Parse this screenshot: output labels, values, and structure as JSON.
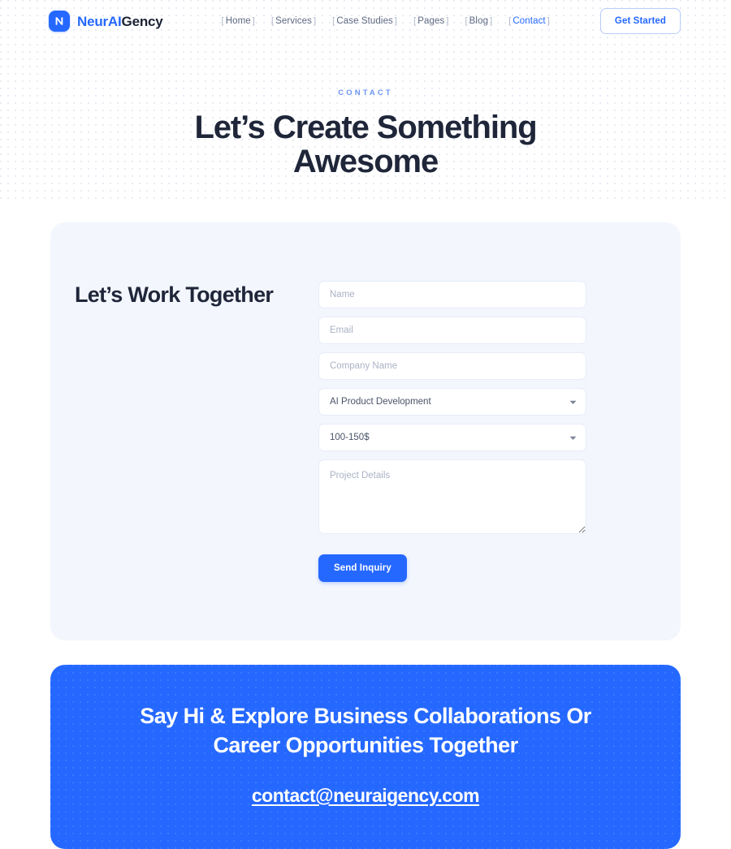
{
  "brand": {
    "icon": "logo-n-mark",
    "name_part1": "NeurAI",
    "name_part2": "Gency",
    "accent_color": "#2568ff"
  },
  "nav": {
    "items": [
      {
        "label": "Home",
        "active": false
      },
      {
        "label": "Services",
        "active": false
      },
      {
        "label": "Case Studies",
        "active": false
      },
      {
        "label": "Pages",
        "active": false
      },
      {
        "label": "Blog",
        "active": false
      },
      {
        "label": "Contact",
        "active": true
      }
    ],
    "bracket_open": "[",
    "bracket_close": "]",
    "cta_label": "Get Started"
  },
  "hero": {
    "eyebrow": "CONTACT",
    "title": "Let’s Create Something Awesome"
  },
  "form_section": {
    "heading": "Let’s Work Together",
    "fields": {
      "name_placeholder": "Name",
      "email_placeholder": "Email",
      "company_placeholder": "Company Name",
      "details_placeholder": "Project Details"
    },
    "service_select": {
      "value": "AI Product Development",
      "options": [
        "AI Product Development"
      ]
    },
    "budget_select": {
      "value": "100-150$",
      "options": [
        "100-150$"
      ]
    },
    "submit_label": "Send Inquiry",
    "caret_icon": "chevron-down-icon"
  },
  "banner": {
    "heading": "Say Hi & Explore Business Collaborations Or Career Opportunities Together",
    "email": "contact@neuraigency.com",
    "background_color": "#2568ff"
  }
}
